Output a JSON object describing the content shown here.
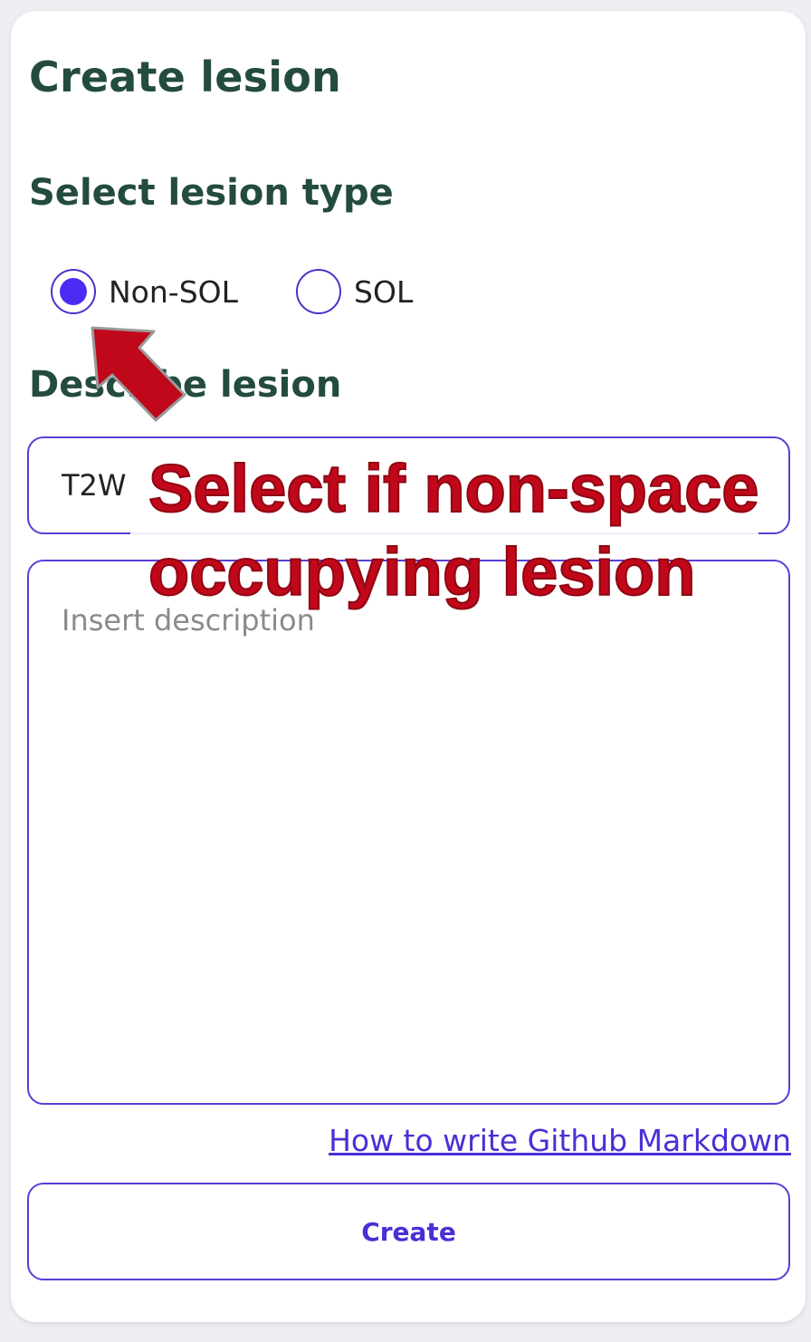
{
  "form": {
    "title": "Create lesion",
    "type_section_title": "Select lesion type",
    "radio_options": [
      {
        "label": "Non-SOL",
        "selected": true
      },
      {
        "label": "SOL",
        "selected": false
      }
    ],
    "describe_section_title": "Describe lesion",
    "title_input_value": "T2W",
    "description_placeholder": "Insert description",
    "markdown_link": "How to write Github Markdown",
    "create_label": "Create"
  },
  "tutorial": {
    "callout_line1": "Select if non-space",
    "callout_line2": "occupying lesion"
  },
  "colors": {
    "accent": "#4c2cf5",
    "heading": "#234b40",
    "callout": "#c0081a"
  }
}
